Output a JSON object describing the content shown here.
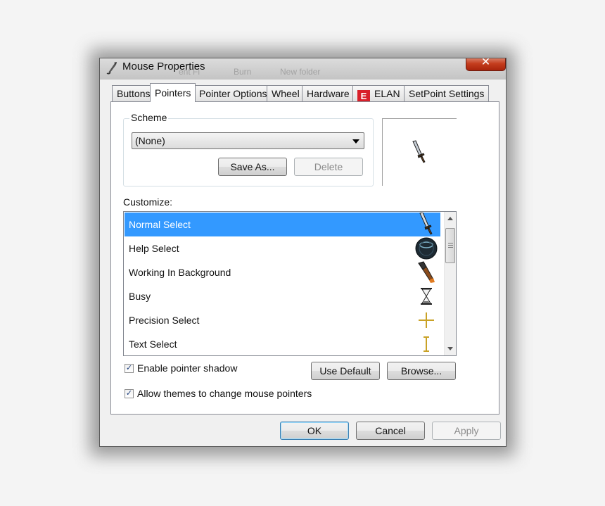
{
  "window": {
    "title": "Mouse Properties",
    "close_label": "✕",
    "background_ghost_text": [
      "ent Fi",
      "Burn",
      "New folder"
    ]
  },
  "tabs": [
    {
      "label": "Buttons",
      "active": false
    },
    {
      "label": "Pointers",
      "active": true
    },
    {
      "label": "Pointer Options",
      "active": false
    },
    {
      "label": "Wheel",
      "active": false
    },
    {
      "label": "Hardware",
      "active": false
    },
    {
      "label": "ELAN",
      "active": false,
      "icon": "elan-icon"
    },
    {
      "label": "SetPoint Settings",
      "active": false
    }
  ],
  "scheme": {
    "group_label": "Scheme",
    "selected": "(None)",
    "save_as_label": "Save As...",
    "delete_label": "Delete"
  },
  "preview": {
    "icon": "sword-cursor-icon"
  },
  "customize": {
    "label": "Customize:",
    "items": [
      {
        "label": "Normal Select",
        "icon": "sword-cursor-icon",
        "selected": true
      },
      {
        "label": "Help Select",
        "icon": "orb-cursor-icon",
        "selected": false
      },
      {
        "label": "Working In Background",
        "icon": "torch-cursor-icon",
        "selected": false
      },
      {
        "label": "Busy",
        "icon": "hourglass-icon",
        "selected": false
      },
      {
        "label": "Precision Select",
        "icon": "crosshair-icon",
        "selected": false
      },
      {
        "label": "Text Select",
        "icon": "ibeam-icon",
        "selected": false
      }
    ]
  },
  "options": {
    "enable_shadow_label": "Enable pointer shadow",
    "enable_shadow_checked": true,
    "allow_themes_label": "Allow themes to change mouse pointers",
    "allow_themes_checked": true,
    "use_default_label": "Use Default",
    "browse_label": "Browse..."
  },
  "footer": {
    "ok_label": "OK",
    "cancel_label": "Cancel",
    "apply_label": "Apply"
  },
  "colors": {
    "selection": "#3399ff",
    "close_button": "#c43c1d"
  }
}
